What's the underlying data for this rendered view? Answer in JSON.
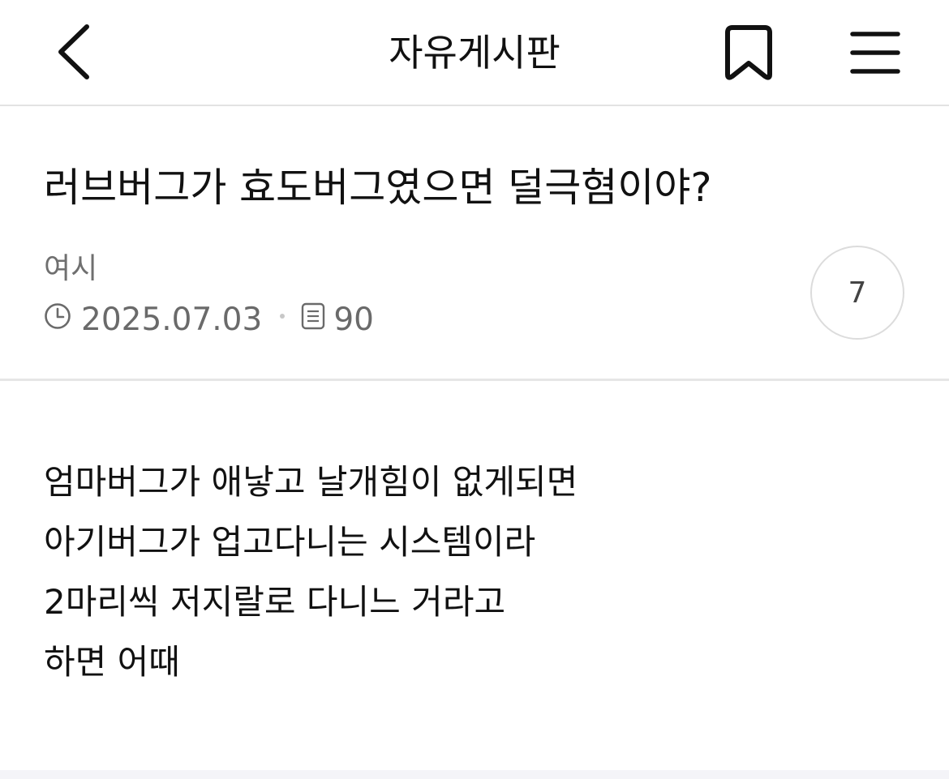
{
  "header": {
    "board_title": "자유게시판",
    "icons": [
      "back-icon",
      "bookmark-icon",
      "menu-icon"
    ]
  },
  "post": {
    "title": "러브버그가 효도버그였으면 덜극혐이야?",
    "author": "여시",
    "date": "2025.07.03",
    "views": "90",
    "comment_count": "7",
    "body_lines": [
      "엄마버그가 애낳고 날개힘이 없게되면",
      "아기버그가 업고다니는 시스템이라",
      "2마리씩 저지랄로 다니느 거라고",
      "하면 어때"
    ]
  },
  "colors": {
    "text": "#111111",
    "meta_text": "#6a6a6a",
    "divider": "#e3e3e3"
  }
}
